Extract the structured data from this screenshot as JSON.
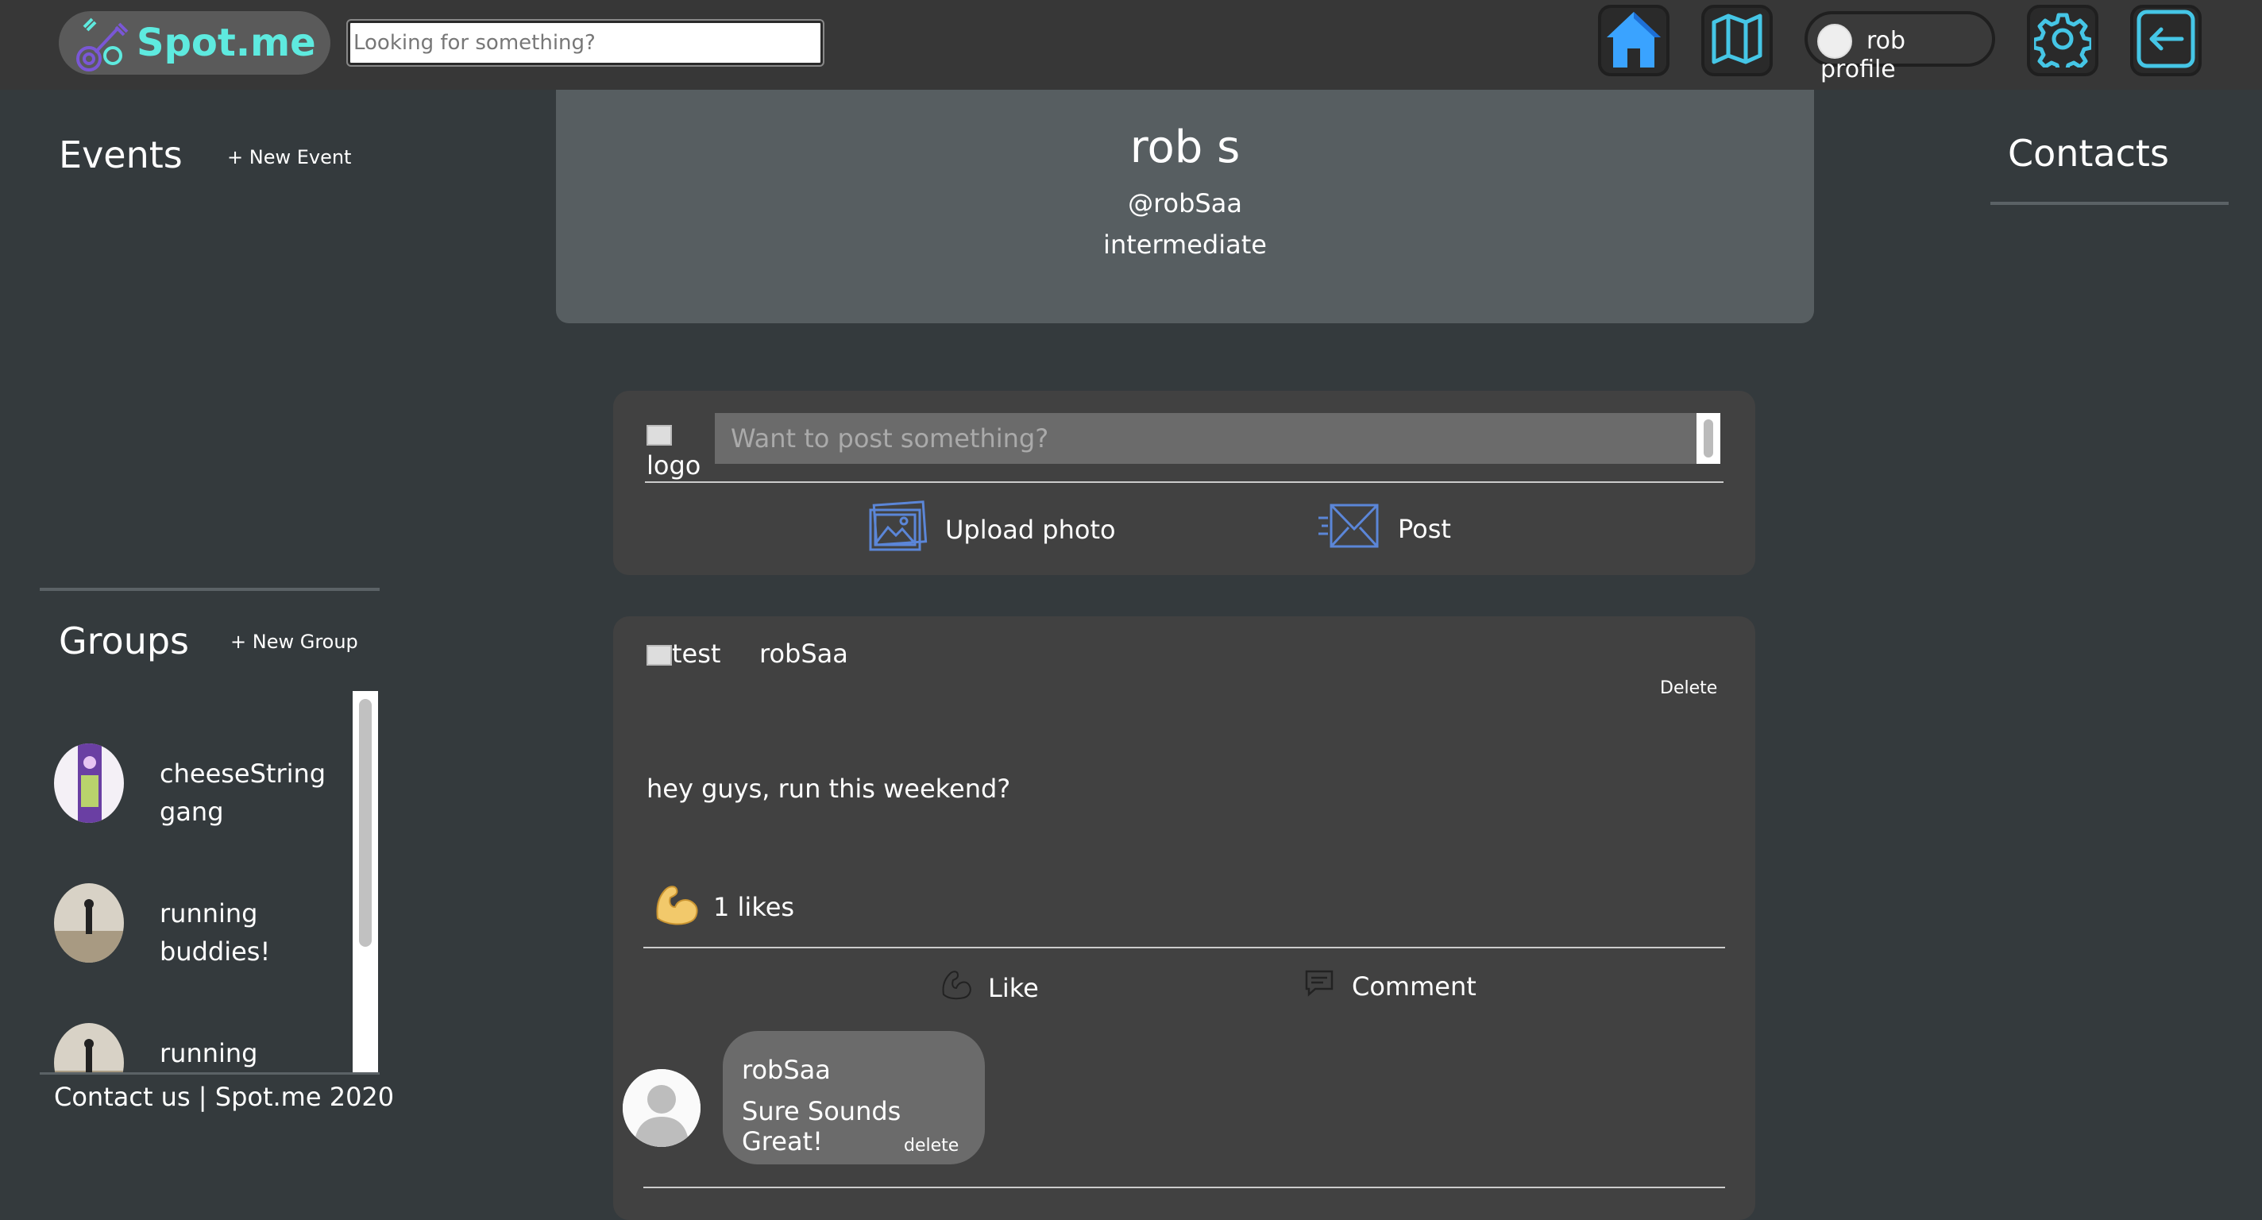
{
  "header": {
    "brand_name": "Spot.me",
    "search_placeholder": "Looking for something?",
    "profile_name": "rob",
    "profile_alt": "profile",
    "icons": [
      "home-icon",
      "map-icon",
      "settings-gear-icon",
      "logout-arrow-icon"
    ],
    "accent_color": "#5eeadf",
    "icon_color": "#44aaff"
  },
  "left_sidebar": {
    "events_title": "Events",
    "new_event": "+ New Event",
    "groups_title": "Groups",
    "new_group": "+ New Group",
    "groups": [
      {
        "name": "cheeseString gang"
      },
      {
        "name": "running buddies!"
      },
      {
        "name": "running buddies!"
      }
    ],
    "footer": "Contact us | Spot.me 2020"
  },
  "profile": {
    "name": "rob s",
    "handle": "@robSaa",
    "level": "intermediate"
  },
  "composer": {
    "logo_alt": "logo",
    "placeholder": "Want to post something?",
    "upload_label": "Upload photo",
    "post_label": "Post"
  },
  "post": {
    "author_img_alt": "test",
    "author": "robSaa",
    "delete_label": "Delete",
    "body": "hey guys, run this weekend?",
    "likes": "1 likes",
    "like_label": "Like",
    "comment_label": "Comment",
    "comment": {
      "author": "robSaa",
      "text": "Sure Sounds Great!",
      "delete_label": "delete"
    }
  },
  "right_sidebar": {
    "contacts_title": "Contacts"
  }
}
